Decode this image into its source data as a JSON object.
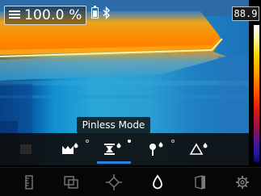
{
  "status": {
    "reading": "100.0 %",
    "rh_icon": "humidity-lines-icon",
    "battery_icon": "battery-icon",
    "bluetooth_icon": "bluetooth-icon"
  },
  "scale": {
    "max_value": "88.9"
  },
  "mode_tooltip": "Pinless Mode",
  "modes": [
    {
      "name": "disabled-mode-icon",
      "active": false
    },
    {
      "name": "material-mode-icon",
      "active": false
    },
    {
      "name": "pinless-mode-icon",
      "active": true
    },
    {
      "name": "pin-mode-icon",
      "active": false
    },
    {
      "name": "delta-mode-icon",
      "active": false
    }
  ],
  "toolbar": [
    {
      "name": "ruler-icon"
    },
    {
      "name": "layers-icon"
    },
    {
      "name": "crosshair-icon"
    },
    {
      "name": "droplet-icon"
    },
    {
      "name": "wall-icon"
    },
    {
      "name": "settings-gear-icon"
    }
  ],
  "colors": {
    "accent": "#2f7fe0",
    "background": "#000000"
  }
}
